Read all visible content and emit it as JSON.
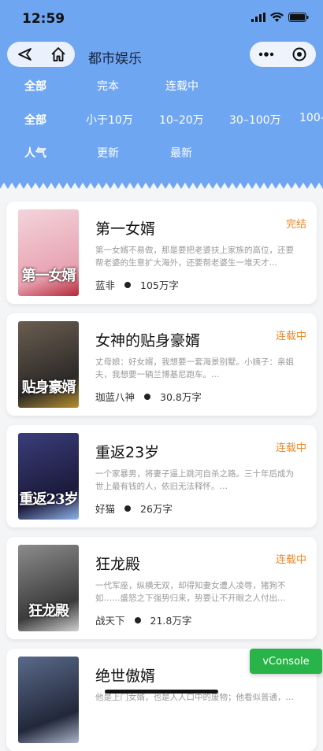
{
  "status_bar": {
    "time": "12:59"
  },
  "nav": {
    "title": "都市娱乐"
  },
  "filters": {
    "status": [
      "全部",
      "完本",
      "连载中"
    ],
    "length": [
      "全部",
      "小于10万",
      "10–20万",
      "30–100万",
      "100–"
    ],
    "sort": [
      "人气",
      "更新",
      "最新"
    ]
  },
  "books": [
    {
      "title": "第一女婿",
      "status": "完结",
      "desc": "第一女婿不易做，那是要把老婆扶上家族的高位，还要帮老婆的生意扩大海外，还要帮老婆生一堆天才…",
      "author": "蓝非",
      "words": "105万字",
      "cover_text": "第一女婿",
      "cover_colors": [
        "#f3d4dc",
        "#e8a3b2",
        "#b52a3a"
      ]
    },
    {
      "title": "女神的贴身豪婿",
      "status": "连载中",
      "desc": "丈母娘：好女婿，我想要一套海景别墅。小姨子：亲姐夫，我想要一辆兰博基尼跑车。…",
      "author": "珈蓝八神",
      "words": "30.8万字",
      "cover_text": "贴身豪婿",
      "cover_colors": [
        "#6a5d50",
        "#2d2a28",
        "#b8902e"
      ]
    },
    {
      "title": "重返23岁",
      "status": "连载中",
      "desc": "一个家暴男，将妻子逼上跳河自杀之路。三十年后成为世上最有钱的人，依旧无法释怀。…",
      "author": "好猫",
      "words": "26万字",
      "cover_text": "重返23岁",
      "cover_colors": [
        "#3a3e7a",
        "#1c1a3c",
        "#8fb4e8"
      ]
    },
    {
      "title": "狂龙殿",
      "status": "连载中",
      "desc": "一代军座，纵横无双，却得知妻女遭人凌辱，猪狗不如……盛怒之下强势归来，势要让不开眼之人付出…",
      "author": "战天下",
      "words": "21.8万字",
      "cover_text": "狂龙殿",
      "cover_colors": [
        "#8c8c8c",
        "#3b3b3b",
        "#d0d0d0"
      ]
    },
    {
      "title": "绝世傲婿",
      "status": "",
      "desc": "他是上门女婿，也是人人口中的废物；他看似普通，…",
      "author": "",
      "words": "",
      "cover_text": "",
      "cover_colors": [
        "#5a6a8a",
        "#22283a",
        "#aab4c8"
      ]
    }
  ],
  "vconsole": {
    "label": "vConsole"
  }
}
